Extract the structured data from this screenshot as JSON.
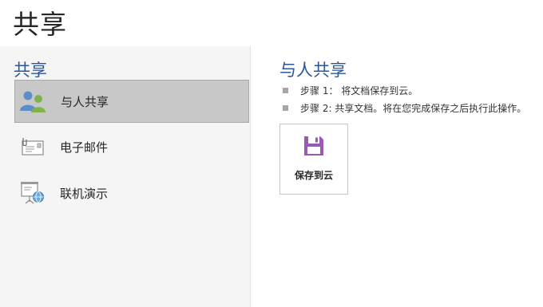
{
  "page": {
    "title": "共享"
  },
  "left": {
    "section_title": "共享",
    "items": [
      {
        "label": "与人共享",
        "icon": "people-icon",
        "selected": true
      },
      {
        "label": "电子邮件",
        "icon": "email-icon",
        "selected": false
      },
      {
        "label": "联机演示",
        "icon": "online-presentation-icon",
        "selected": false
      }
    ]
  },
  "right": {
    "title": "与人共享",
    "steps": [
      "步骤 1： 将文档保存到云。",
      "步骤 2: 共享文档。将在您完成保存之后执行此操作。"
    ],
    "save_button": {
      "label": "保存到云",
      "icon": "save-icon",
      "color": "#9b59b6"
    }
  },
  "colors": {
    "accent": "#2b579a",
    "selected_bg": "#c8c8c8",
    "panel_bg": "#f5f5f5"
  }
}
